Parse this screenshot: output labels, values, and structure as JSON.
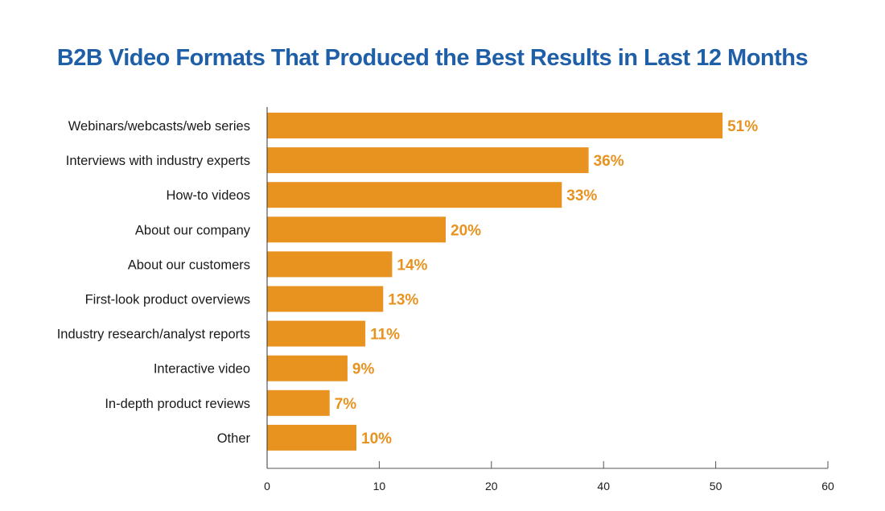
{
  "chart_data": {
    "type": "bar",
    "orientation": "horizontal",
    "title": "B2B Video Formats That Produced the Best Results in Last 12 Months",
    "xlabel": "",
    "ylabel": "",
    "categories": [
      "Webinars/webcasts/web series",
      "Interviews with industry experts",
      "How-to videos",
      "About our company",
      "About our customers",
      "First-look product overviews",
      "Industry research/analyst reports",
      "Interactive video",
      "In-depth product reviews",
      "Other"
    ],
    "values": [
      51,
      36,
      33,
      20,
      14,
      13,
      11,
      9,
      7,
      10
    ],
    "value_labels": [
      "51%",
      "36%",
      "33%",
      "20%",
      "14%",
      "13%",
      "11%",
      "9%",
      "7%",
      "10%"
    ],
    "x_tick_labels": [
      "0",
      "10",
      "20",
      "40",
      "50",
      "60"
    ],
    "xlim": [
      0,
      60
    ],
    "grid": false,
    "legend": "none",
    "colors": {
      "bar": "#e8921f",
      "title": "#1f5fa8",
      "value_label": "#e8921f"
    }
  }
}
